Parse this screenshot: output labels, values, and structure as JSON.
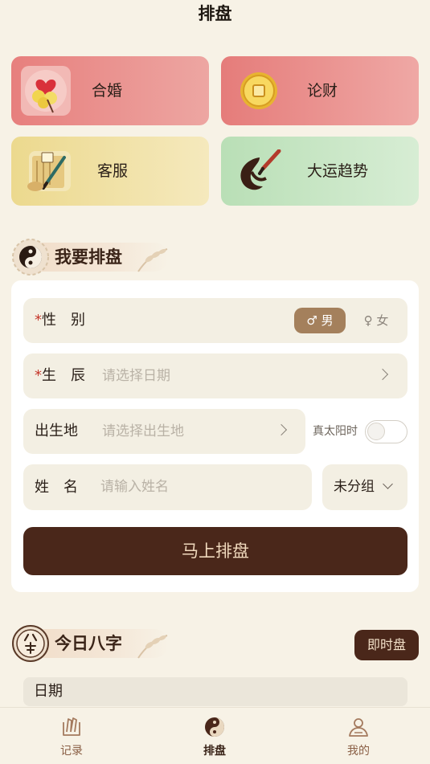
{
  "header": {
    "title": "排盘"
  },
  "features": [
    {
      "label": "合婚",
      "icon": "marriage-icon"
    },
    {
      "label": "论财",
      "icon": "coin-icon"
    },
    {
      "label": "客服",
      "icon": "scroll-brush-icon"
    },
    {
      "label": "大运趋势",
      "icon": "ink-brush-icon"
    }
  ],
  "my_chart": {
    "title": "我要排盘",
    "gender": {
      "required": "*",
      "label": "性　别",
      "male": "♂ 男",
      "female": "♀ 女",
      "selected": "male"
    },
    "birthtime": {
      "required": "*",
      "label": "生　辰",
      "placeholder": "请选择日期"
    },
    "birthplace": {
      "label": "出生地",
      "placeholder": "请选择出生地"
    },
    "solar_time": {
      "label": "真太阳时",
      "enabled": false
    },
    "name": {
      "label": "姓　名",
      "placeholder": "请输入姓名"
    },
    "group": {
      "value": "未分组"
    },
    "submit_label": "马上排盘"
  },
  "today_bazi": {
    "title": "今日八字",
    "instant_label": "即时盘",
    "date_header": "日期"
  },
  "tabbar": [
    {
      "label": "记录",
      "icon": "record-icon",
      "active": false
    },
    {
      "label": "排盘",
      "icon": "yin-yang-icon",
      "active": true
    },
    {
      "label": "我的",
      "icon": "profile-icon",
      "active": false
    }
  ],
  "colors": {
    "background": "#f7f2e6",
    "primary_brown": "#4a271a",
    "accent_tan": "#a4805c",
    "required_red": "#c5382c"
  }
}
